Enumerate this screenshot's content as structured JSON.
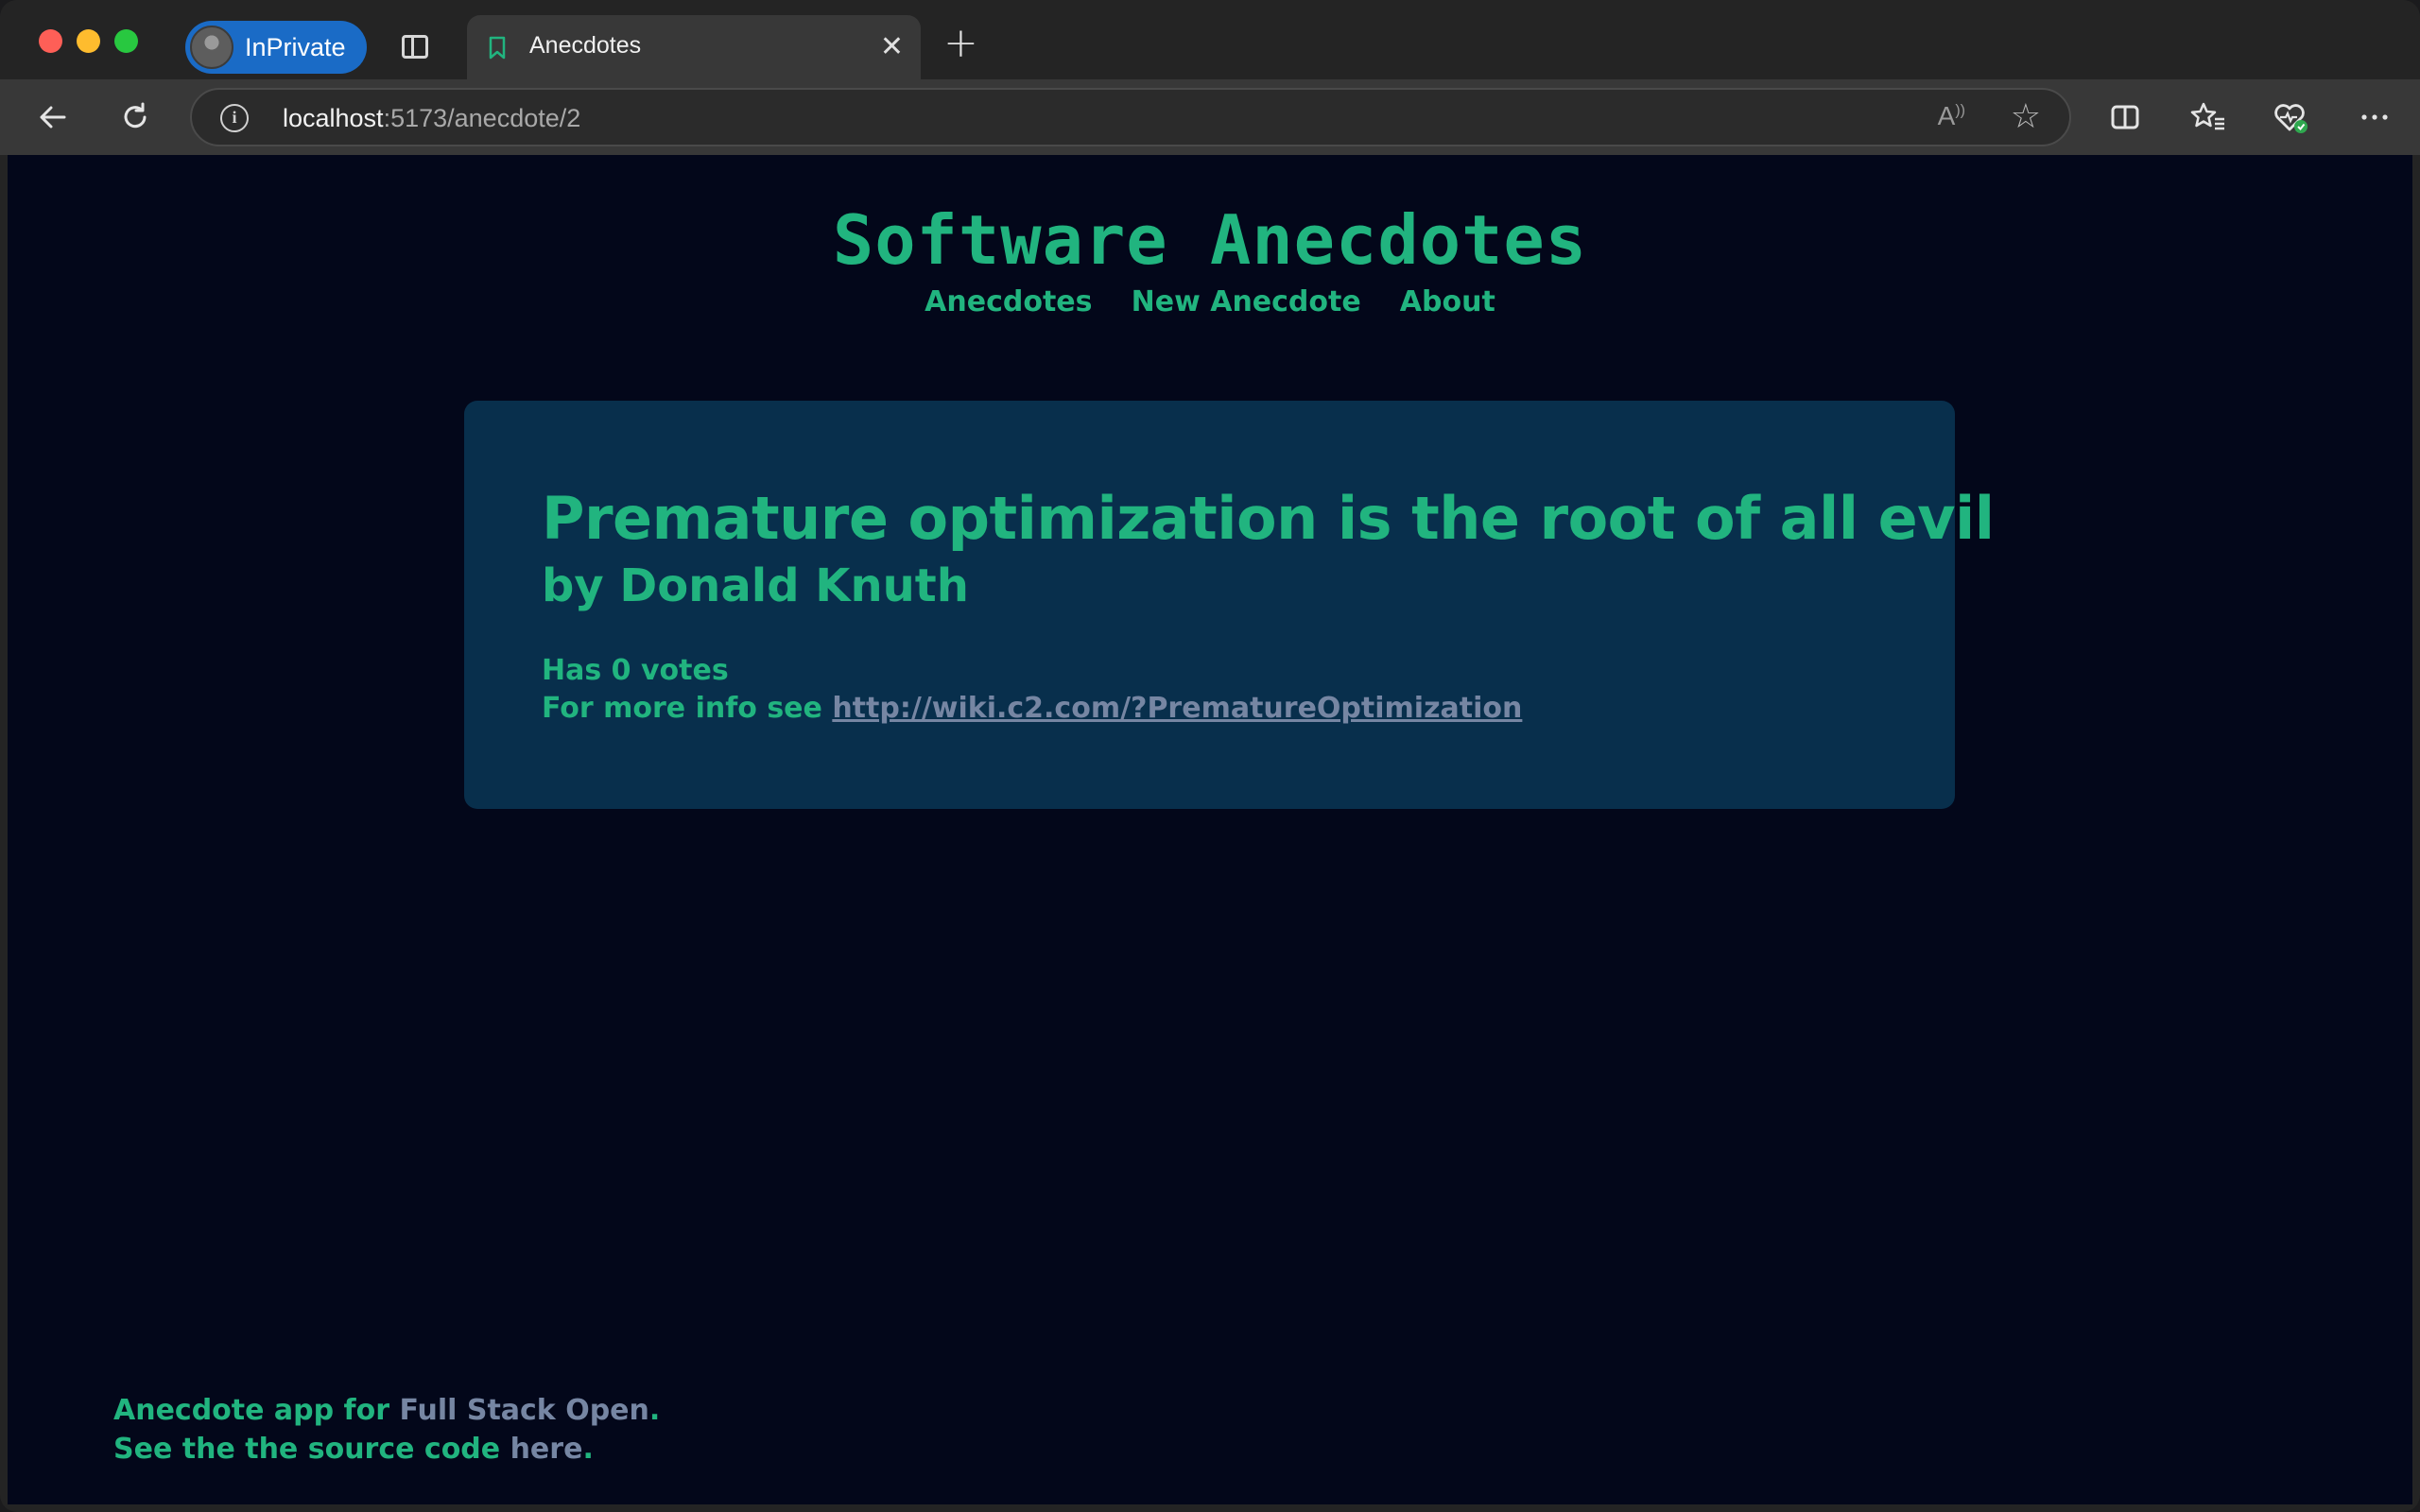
{
  "browser": {
    "profile_label": "InPrivate",
    "tab_title": "Anecdotes",
    "url_host": "localhost",
    "url_path": ":5173/anecdote/2"
  },
  "site": {
    "title": "Software Anecdotes",
    "nav": [
      "Anecdotes",
      "New Anecdote",
      "About"
    ]
  },
  "anecdote": {
    "content": "Premature optimization is the root of all evil",
    "author_line": "by Donald Knuth",
    "votes_text": "Has 0 votes",
    "info_prefix": "For more info see ",
    "info_url": "http://wiki.c2.com/?PrematureOptimization"
  },
  "footer": {
    "line1_prefix": "Anecdote app for ",
    "line1_link": "Full Stack Open",
    "line1_suffix": ".",
    "line2_prefix": "See the the source code ",
    "line2_link": "here",
    "line2_suffix": "."
  },
  "colors": {
    "accent": "#21b47f",
    "page_bg": "#03071a",
    "card_bg": "#082f4c",
    "link": "#7686a3"
  }
}
